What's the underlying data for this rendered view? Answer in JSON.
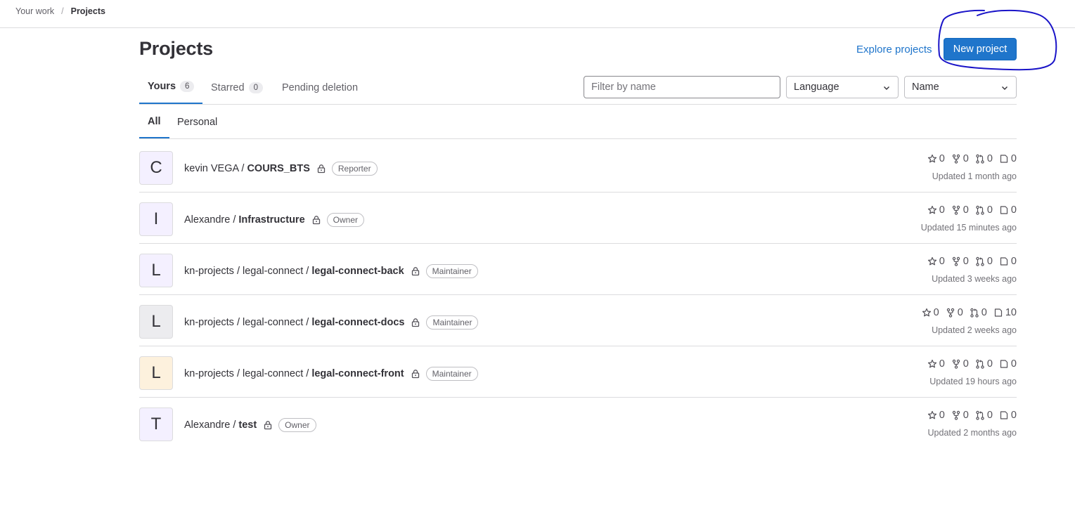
{
  "breadcrumb": {
    "parent": "Your work",
    "separator": "/",
    "current": "Projects"
  },
  "header": {
    "title": "Projects",
    "explore_label": "Explore projects",
    "new_project_label": "New project",
    "highlight_color": "#1a14c8"
  },
  "tabs": [
    {
      "label": "Yours",
      "count": "6",
      "active": true
    },
    {
      "label": "Starred",
      "count": "0",
      "active": false
    },
    {
      "label": "Pending deletion",
      "active": false
    }
  ],
  "filters": {
    "search_placeholder": "Filter by name",
    "search_value": "",
    "language_label": "Language",
    "sort_label": "Name"
  },
  "subtabs": [
    {
      "label": "All",
      "active": true
    },
    {
      "label": "Personal",
      "active": false
    }
  ],
  "projects": [
    {
      "initial": "C",
      "avatar_bg": "#f4f0ff",
      "namespace": "kevin VEGA /",
      "name": "COURS_BTS",
      "role": "Reporter",
      "stars": "0",
      "forks": "0",
      "merge_requests": "0",
      "issues": "0",
      "updated": "Updated 1 month ago"
    },
    {
      "initial": "I",
      "avatar_bg": "#f4f0ff",
      "namespace": "Alexandre /",
      "name": "Infrastructure",
      "role": "Owner",
      "stars": "0",
      "forks": "0",
      "merge_requests": "0",
      "issues": "0",
      "updated": "Updated 15 minutes ago"
    },
    {
      "initial": "L",
      "avatar_bg": "#f4f0ff",
      "namespace": "kn-projects / legal-connect /",
      "name": "legal-connect-back",
      "role": "Maintainer",
      "stars": "0",
      "forks": "0",
      "merge_requests": "0",
      "issues": "0",
      "updated": "Updated 3 weeks ago"
    },
    {
      "initial": "L",
      "avatar_bg": "#ececef",
      "namespace": "kn-projects / legal-connect /",
      "name": "legal-connect-docs",
      "role": "Maintainer",
      "stars": "0",
      "forks": "0",
      "merge_requests": "0",
      "issues": "10",
      "updated": "Updated 2 weeks ago"
    },
    {
      "initial": "L",
      "avatar_bg": "#fdf1dd",
      "namespace": "kn-projects / legal-connect /",
      "name": "legal-connect-front",
      "role": "Maintainer",
      "stars": "0",
      "forks": "0",
      "merge_requests": "0",
      "issues": "0",
      "updated": "Updated 19 hours ago"
    },
    {
      "initial": "T",
      "avatar_bg": "#f4f0ff",
      "namespace": "Alexandre /",
      "name": "test",
      "role": "Owner",
      "stars": "0",
      "forks": "0",
      "merge_requests": "0",
      "issues": "0",
      "updated": "Updated 2 months ago"
    }
  ]
}
